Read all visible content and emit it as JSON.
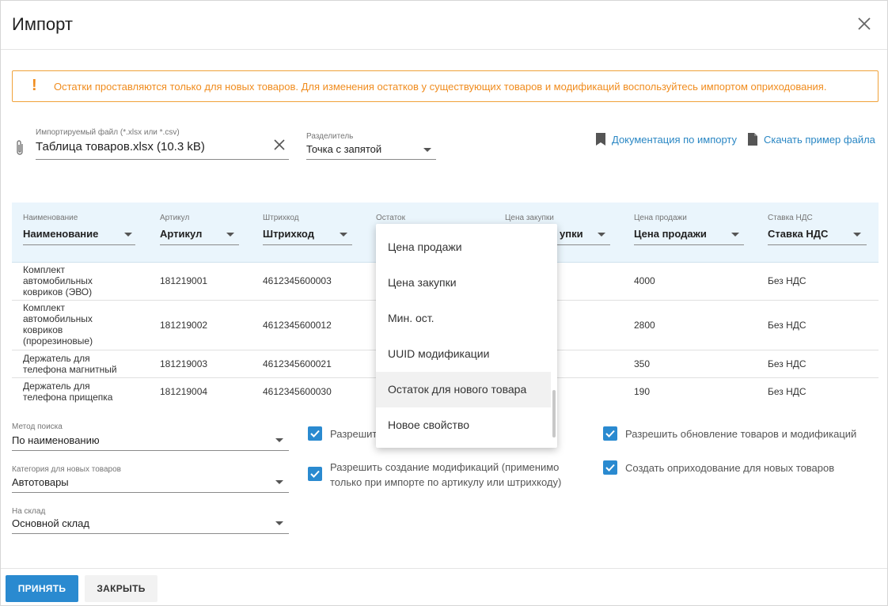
{
  "dialog": {
    "title": "Импорт"
  },
  "alert": {
    "mark": "!",
    "text": "Остатки проставляются только для новых товаров. Для изменения остатков у существующих товаров и модификаций воспользуйтесь импортом оприходования."
  },
  "file": {
    "label": "Импортируемый файл (*.xlsx или *.csv)",
    "value": "Таблица товаров.xlsx (10.3 kB)"
  },
  "separator": {
    "label": "Разделитель",
    "value": "Точка с запятой"
  },
  "links": {
    "docs": "Документация по импорту",
    "sample": "Скачать пример файла"
  },
  "table": {
    "columns": [
      {
        "label": "Наименование",
        "value": "Наименование"
      },
      {
        "label": "Артикул",
        "value": "Артикул"
      },
      {
        "label": "Штрихкод",
        "value": "Штрихкод"
      },
      {
        "label": "Остаток",
        "value": ""
      },
      {
        "label": "Цена закупки",
        "value": "упки"
      },
      {
        "label": "Цена продажи",
        "value": "Цена продажи"
      },
      {
        "label": "Ставка НДС",
        "value": "Ставка НДС"
      }
    ],
    "rows": [
      {
        "name": "Комплект автомобильных ковриков (ЭВО)",
        "sku": "181219001",
        "barcode": "4612345600003",
        "price": "4000",
        "vat": "Без НДС"
      },
      {
        "name": "Комплект автомобильных ковриков (прорезиновые)",
        "sku": "181219002",
        "barcode": "4612345600012",
        "price": "2800",
        "vat": "Без НДС"
      },
      {
        "name": "Держатель для телефона магнитный",
        "sku": "181219003",
        "barcode": "4612345600021",
        "price": "350",
        "vat": "Без НДС"
      },
      {
        "name": "Держатель для телефона прищепка",
        "sku": "181219004",
        "barcode": "4612345600030",
        "price": "190",
        "vat": "Без НДС"
      }
    ]
  },
  "dropdown": {
    "items": [
      "Цена продажи",
      "Цена закупки",
      "Мин. ост.",
      "UUID модификации",
      "Остаток для нового товара",
      "Новое свойство"
    ]
  },
  "search_method": {
    "label": "Метод поиска",
    "value": "По наименованию"
  },
  "category": {
    "label": "Категория для новых товаров",
    "value": "Автотовары"
  },
  "warehouse": {
    "label": "На склад",
    "value": "Основной склад"
  },
  "options": {
    "allow_create_partial": "Разрешит",
    "allow_modifications": "Разрешить создание модификаций (применимо только при импорте по артикулу или штрихкоду)",
    "allow_update": "Разрешить обновление товаров и модификаций",
    "create_receipt": "Создать оприходование для новых товаров"
  },
  "footer": {
    "accept": "ПРИНЯТЬ",
    "close": "ЗАКРЫТЬ"
  },
  "colors": {
    "accent": "#2a8ad0",
    "warning": "#f08c1e",
    "link": "#2a87c4",
    "table_header_bg": "#eaf5fc"
  }
}
